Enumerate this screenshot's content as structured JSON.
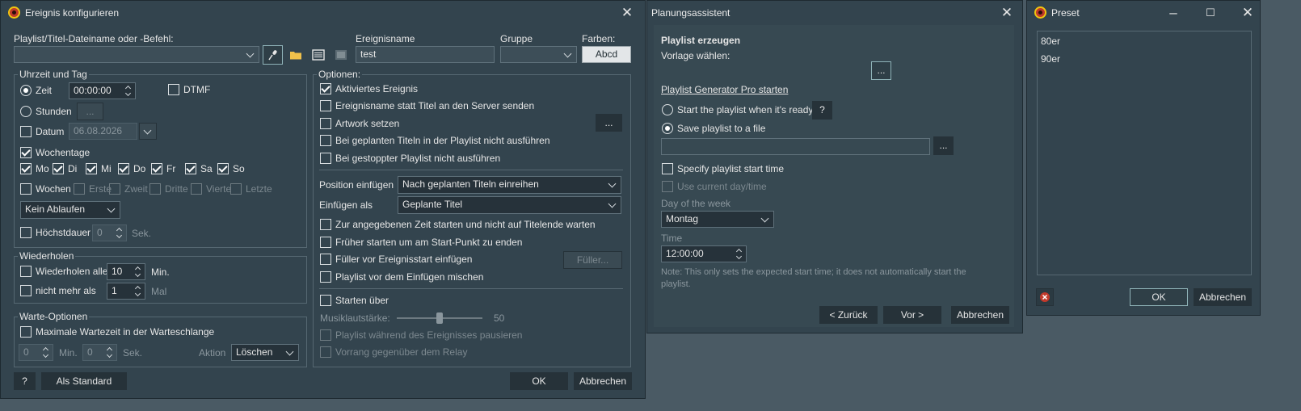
{
  "event": {
    "title": "Ereignis konfigurieren",
    "playlist_label": "Playlist/Titel-Dateiname oder -Befehl:",
    "eventname_label": "Ereignisname",
    "eventname_value": "test",
    "group_label": "Gruppe",
    "colors_label": "Farben:",
    "colors_button": "Abcd",
    "time_group": {
      "title": "Uhrzeit und Tag",
      "zeit_label": "Zeit",
      "zeit_value": "00:00:00",
      "dtmf_label": "DTMF",
      "stunden_label": "Stunden",
      "stunden_button": "...",
      "datum_label": "Datum",
      "datum_value": "06.08.2026",
      "wochentage_label": "Wochentage",
      "days": [
        "Mo",
        "Di",
        "Mi",
        "Do",
        "Fr",
        "Sa",
        "So"
      ],
      "wochen_label": "Wochen",
      "weeks": [
        "Erste",
        "Zweit",
        "Dritte",
        "Vierte",
        "Letzte"
      ],
      "expiry_value": "Kein Ablaufen",
      "maxdur_label": "Höchstdauer",
      "maxdur_value": "0",
      "maxdur_unit": "Sek."
    },
    "repeat_group": {
      "title": "Wiederholen",
      "every_label": "Wiederholen alle",
      "every_value": "10",
      "every_unit": "Min.",
      "max_label": "nicht mehr als",
      "max_value": "1",
      "max_unit": "Mal"
    },
    "wait_group": {
      "title": "Warte-Optionen",
      "maxwait_label": "Maximale Wartezeit in der Warteschlange",
      "min_value": "0",
      "min_unit": "Min.",
      "sec_value": "0",
      "sec_unit": "Sek.",
      "action_label": "Aktion",
      "action_value": "Löschen"
    },
    "options": {
      "title": "Optionen:",
      "items": [
        "Aktiviertes Ereignis",
        "Ereignisname statt Titel an den Server senden",
        "Artwork setzen",
        "Bei geplanten Titeln in der Playlist nicht ausführen",
        "Bei gestoppter Playlist nicht ausführen"
      ],
      "artwork_button": "...",
      "position_label": "Position einfügen",
      "position_value": "Nach geplanten Titeln einreihen",
      "insert_label": "Einfügen als",
      "insert_value": "Geplante Titel",
      "items2": [
        "Zur angegebenen Zeit starten und nicht auf Titelende warten",
        "Früher starten um am Start-Punkt zu enden",
        "Füller vor Ereignisstart einfügen",
        "Playlist vor dem Einfügen mischen"
      ],
      "filler_button": "Füller...",
      "start_over_label": "Starten über",
      "music_volume_label": "Musiklautstärke:",
      "music_volume_value": "50",
      "music_volume_fraction": 0.5,
      "pause_label": "Playlist während des Ereignisses pausieren",
      "priority_label": "Vorrang gegenüber dem Relay"
    },
    "help_button": "?",
    "default_button": "Als Standard",
    "ok_button": "OK",
    "cancel_button": "Abbrechen"
  },
  "wizard": {
    "title": "Planungsassistent",
    "section_title": "Playlist erzeugen",
    "template_label": "Vorlage wählen:",
    "browse_button": "...",
    "pro_link": "Playlist Generator Pro starten",
    "radio1": "Start the playlist when it's ready",
    "help_button": "?",
    "radio2": "Save playlist to a file",
    "file_button": "...",
    "specify_label": "Specify playlist start time",
    "current_label": "Use current day/time",
    "dow_label": "Day of the week",
    "dow_value": "Montag",
    "time_label": "Time",
    "time_value": "12:00:00",
    "note": "Note: This only sets the expected start time; it does not automatically start the playlist.",
    "back_button": "< Zurück",
    "next_button": "Vor >",
    "cancel_button": "Abbrechen"
  },
  "preset": {
    "title": "Preset",
    "items": [
      "80er",
      "90er"
    ],
    "ok_button": "OK",
    "cancel_button": "Abbrechen"
  }
}
